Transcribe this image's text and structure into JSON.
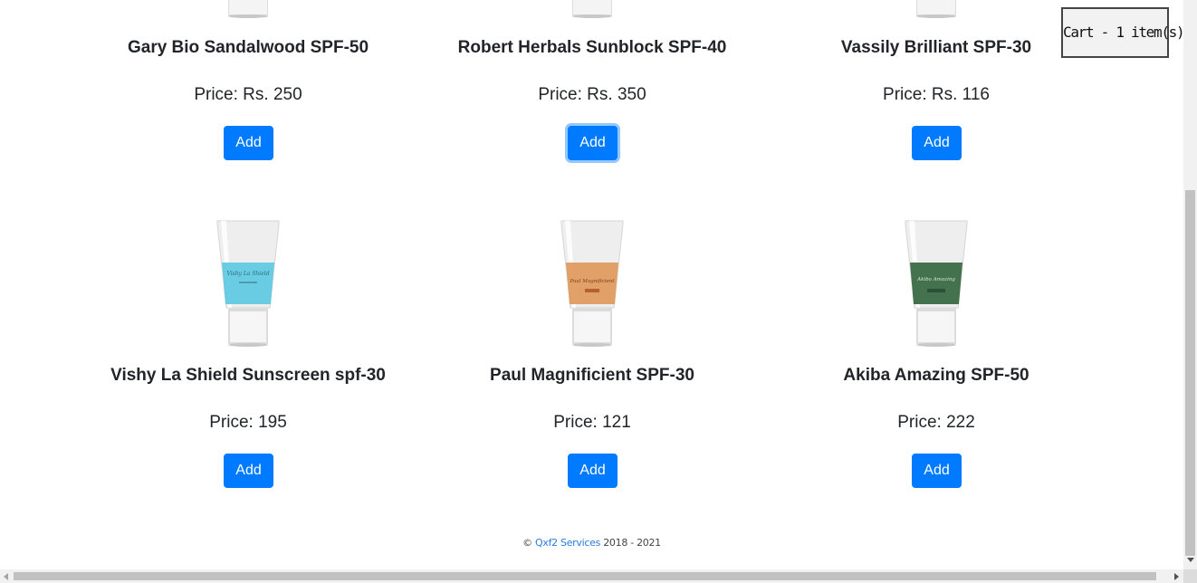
{
  "cart": {
    "label": "Cart - 1 item(s)"
  },
  "products": [
    {
      "name": "Gary Bio Sandalwood SPF-50",
      "price": "Price: Rs. 250",
      "add_label": "Add",
      "band_color": "#e8e8e8",
      "label_text": ""
    },
    {
      "name": "Robert Herbals Sunblock SPF-40",
      "price": "Price: Rs. 350",
      "add_label": "Add",
      "band_color": "#e8e8e8",
      "label_text": ""
    },
    {
      "name": "Vassily Brilliant SPF-30",
      "price": "Price: Rs. 116",
      "add_label": "Add",
      "band_color": "#e8e8e8",
      "label_text": ""
    },
    {
      "name": "Vishy La Shield Sunscreen spf-30",
      "price": "Price: 195",
      "add_label": "Add",
      "band_color": "#5bc8e0",
      "label_text": "Vishy La Shield"
    },
    {
      "name": "Paul Magnificient SPF-30",
      "price": "Price: 121",
      "add_label": "Add",
      "band_color": "#e0975a",
      "label_text": "Paul Magnificient"
    },
    {
      "name": "Akiba Amazing SPF-50",
      "price": "Price: 222",
      "add_label": "Add",
      "band_color": "#3a6a45",
      "label_text": "Akiba Amazing"
    }
  ],
  "footer": {
    "copyright": "©",
    "company": "Qxf2 Services",
    "years": "2018 - 2021"
  }
}
